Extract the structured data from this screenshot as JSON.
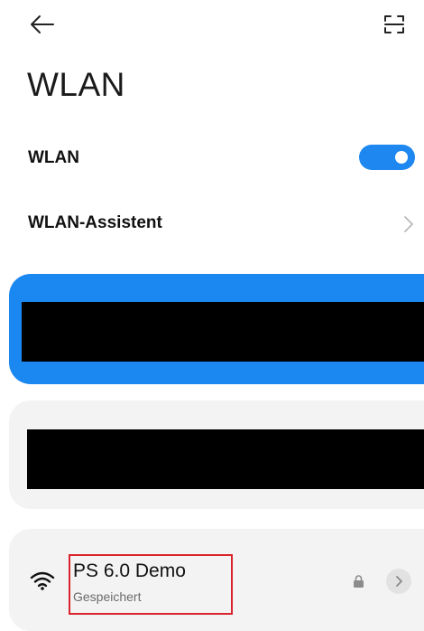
{
  "header": {
    "back_icon": "arrow-left-icon",
    "scan_icon": "qr-scan-icon"
  },
  "page": {
    "title": "WLAN"
  },
  "settings": {
    "wlan_label": "WLAN",
    "wlan_enabled": true,
    "assistant_label": "WLAN-Assistent"
  },
  "networks": [
    {
      "name": "",
      "status": "",
      "redacted": true,
      "connected": true
    },
    {
      "name": "",
      "status": "",
      "redacted": true,
      "connected": false
    },
    {
      "name": "PS 6.0 Demo",
      "status": "Gespeichert",
      "secured": true,
      "highlighted": true
    }
  ],
  "colors": {
    "accent": "#1e88f0",
    "card_background": "#f3f3f3",
    "highlight": "#d9232d"
  }
}
